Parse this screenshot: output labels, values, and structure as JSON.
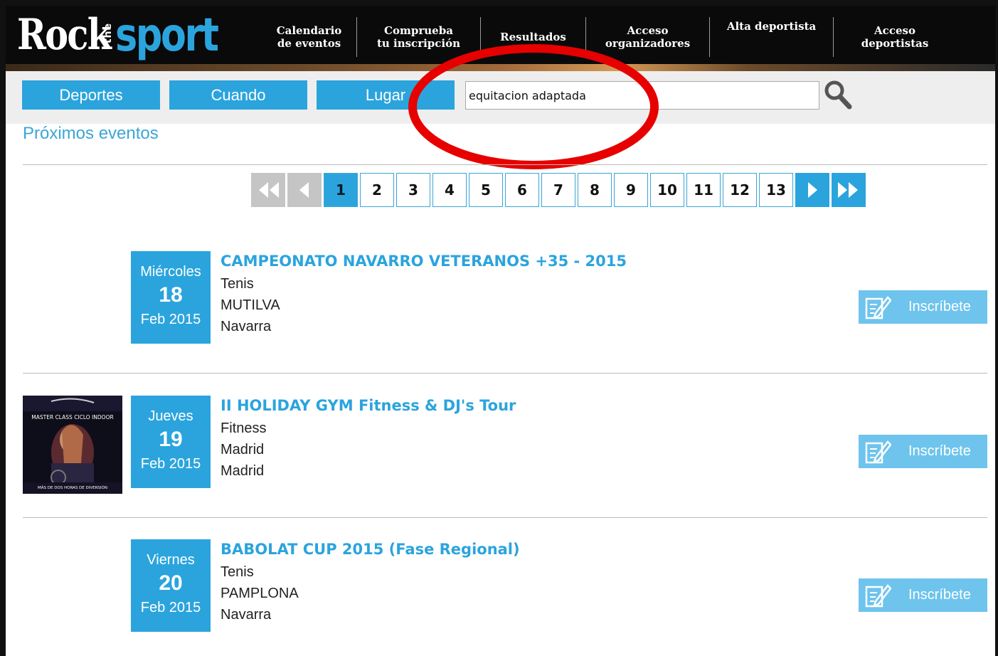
{
  "logo": {
    "rock": "Rock",
    "the": "the",
    "sport": "sport"
  },
  "nav": [
    {
      "label": "Calendario\nde eventos"
    },
    {
      "label": "Comprueba\ntu inscripción"
    },
    {
      "label": "Resultados"
    },
    {
      "label": "Acceso\norganizadores"
    },
    {
      "label": "Alta deportista"
    },
    {
      "label": "Acceso\ndeportistas"
    }
  ],
  "filters": {
    "sports": "Deportes",
    "when": "Cuando",
    "place": "Lugar"
  },
  "search": {
    "value": "equitacion adaptada"
  },
  "section_title": "Próximos eventos",
  "pagination": {
    "pages": [
      "1",
      "2",
      "3",
      "4",
      "5",
      "6",
      "7",
      "8",
      "9",
      "10",
      "11",
      "12",
      "13"
    ],
    "current": "1"
  },
  "events": [
    {
      "day": "Miércoles",
      "date": "18",
      "month": "Feb 2015",
      "title": "CAMPEONATO NAVARRO VETERANOS +35 - 2015",
      "sport": "Tenis",
      "city": "MUTILVA",
      "region": "Navarra",
      "has_image": false,
      "register_label": "Inscríbete"
    },
    {
      "day": "Jueves",
      "date": "19",
      "month": "Feb 2015",
      "title": "II HOLIDAY GYM Fitness & DJ's Tour",
      "sport": "Fitness",
      "city": "Madrid",
      "region": "Madrid",
      "has_image": true,
      "image_text_top": "MASTER CLASS CICLO INDOOR",
      "image_text_bottom": "MÁS DE DOS HORAS DE DIVERSIÓN",
      "register_label": "Inscríbete"
    },
    {
      "day": "Viernes",
      "date": "20",
      "month": "Feb 2015",
      "title": "BABOLAT CUP 2015 (Fase Regional)",
      "sport": "Tenis",
      "city": "PAMPLONA",
      "region": "Navarra",
      "has_image": false,
      "register_label": "Inscríbete"
    }
  ],
  "colors": {
    "accent": "#2ba4dd",
    "annotation": "#e60000",
    "header_bg": "#0a0a0a"
  }
}
